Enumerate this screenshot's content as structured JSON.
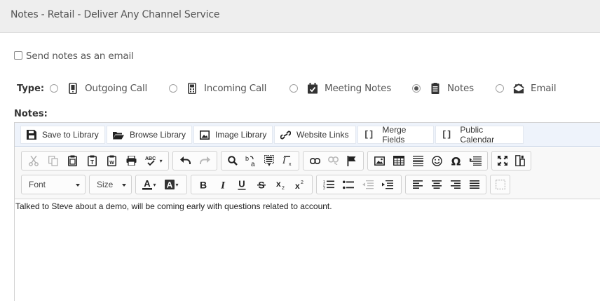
{
  "header": {
    "title": "Notes - Retail - Deliver Any Channel Service"
  },
  "email_option": {
    "label": "Send notes as an email",
    "checked": false
  },
  "type": {
    "label": "Type:",
    "options": [
      {
        "label": "Outgoing Call",
        "icon": "mobile-phone-icon",
        "checked": false
      },
      {
        "label": "Incoming Call",
        "icon": "desk-phone-icon",
        "checked": false
      },
      {
        "label": "Meeting Notes",
        "icon": "calendar-check-icon",
        "checked": false
      },
      {
        "label": "Notes",
        "icon": "note-icon",
        "checked": true
      },
      {
        "label": "Email",
        "icon": "email-envelope-icon",
        "checked": false
      }
    ]
  },
  "notes_label": "Notes:",
  "library_bar": {
    "save": "Save to Library",
    "browse": "Browse Library",
    "image": "Image Library",
    "links": "Website Links",
    "merge": "Merge Fields",
    "calendar": "Public Calendar",
    "bracket": "[]"
  },
  "toolbar": {
    "font_label": "Font",
    "size_label": "Size"
  },
  "editor": {
    "content": "Talked to Steve about a demo, will be coming early with questions related to account."
  },
  "colors": {
    "header_bg": "#eeeeee",
    "lib_bar_bg": "#eef3fb",
    "toolbar_bg": "#f8f8f8"
  }
}
